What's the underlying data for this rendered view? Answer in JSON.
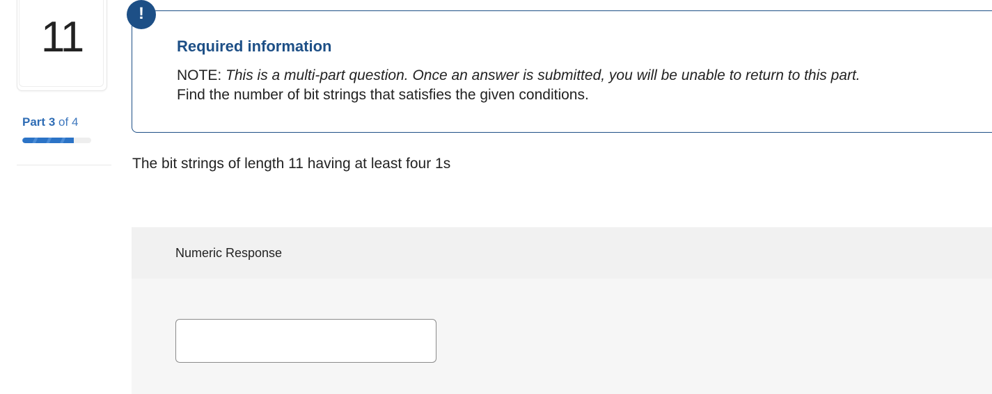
{
  "question": {
    "number": "11",
    "part_word": "Part",
    "part_current": "3",
    "part_of": "of",
    "part_total": "4",
    "progress_fraction": 0.75
  },
  "required_info": {
    "badge": "!",
    "title": "Required information",
    "note_prefix": "NOTE:",
    "note_italic": "This is a multi-part question. Once an answer is submitted, you will be unable to return to this part.",
    "instruction": "Find the number of bit strings that satisfies the given conditions."
  },
  "question_text": "The bit strings of length 11 having at least four 1s",
  "response": {
    "label": "Numeric Response",
    "value": "",
    "placeholder": ""
  },
  "colors": {
    "accent": "#1d4f86",
    "progress": "#2b73c6",
    "panel_bg": "#f6f6f6"
  },
  "icons": {
    "alert": "exclamation-icon"
  }
}
